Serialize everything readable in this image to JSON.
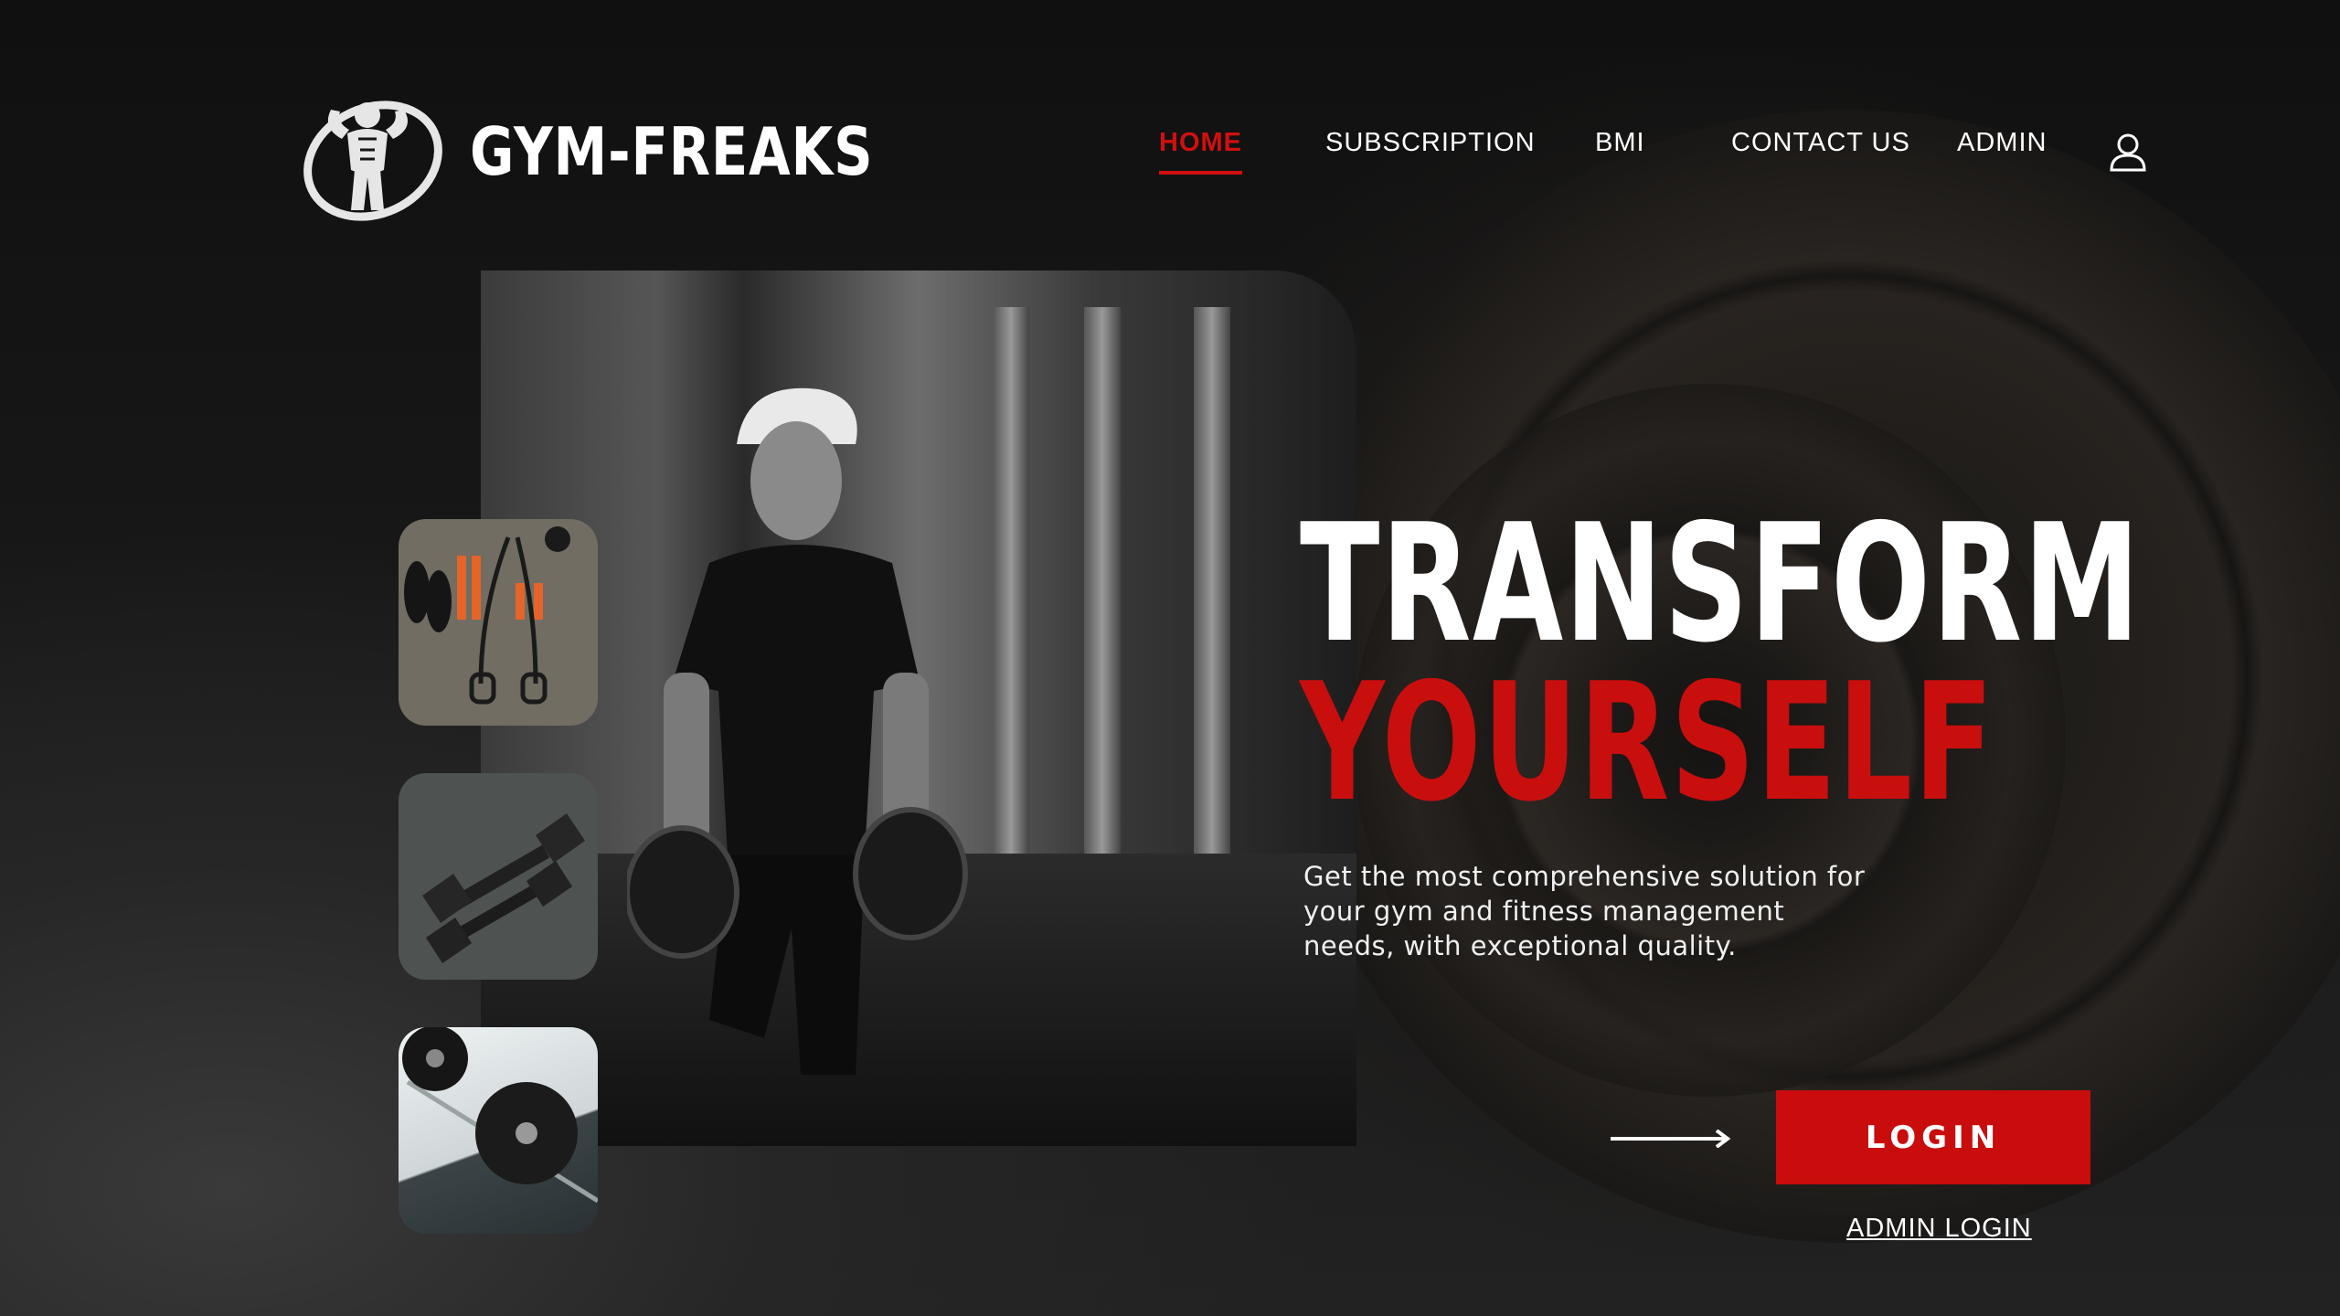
{
  "brand": {
    "name": "GYM-FREAKS",
    "logo_icon": "bodybuilder-logo-icon"
  },
  "nav": {
    "items": [
      {
        "label": "HOME",
        "active": true
      },
      {
        "label": "SUBSCRIPTION",
        "active": false
      },
      {
        "label": "BMI",
        "active": false
      },
      {
        "label": "CONTACT US",
        "active": false
      },
      {
        "label": "ADMIN",
        "active": false
      }
    ],
    "user_icon": "user-icon"
  },
  "hero": {
    "headline_line1": "TRANSFORM",
    "headline_line2": "YOURSELF",
    "tagline": "Get the most comprehensive solution for your gym and fitness management needs, with exceptional quality.",
    "login_label": "LOGIN",
    "admin_login_label": "ADMIN LOGIN"
  },
  "colors": {
    "accent": "#c90e0e",
    "background": "#141414",
    "text": "#ffffff"
  }
}
